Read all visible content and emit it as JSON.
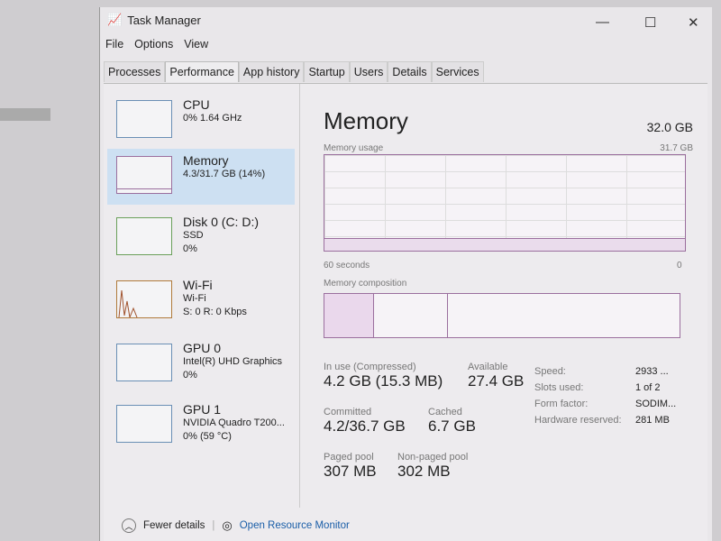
{
  "window": {
    "title": "Task Manager"
  },
  "menu": [
    "File",
    "Options",
    "View"
  ],
  "tabs": [
    "Processes",
    "Performance",
    "App history",
    "Startup",
    "Users",
    "Details",
    "Services"
  ],
  "active_tab": "Performance",
  "sidebar": [
    {
      "name": "CPU",
      "line1": "0% 1.64 GHz",
      "line2": ""
    },
    {
      "name": "Memory",
      "line1": "4.3/31.7 GB (14%)",
      "line2": ""
    },
    {
      "name": "Disk 0 (C: D:)",
      "line1": "SSD",
      "line2": "0%"
    },
    {
      "name": "Wi-Fi",
      "line1": "Wi-Fi",
      "line2": "S: 0 R: 0 Kbps"
    },
    {
      "name": "GPU 0",
      "line1": "Intel(R) UHD Graphics",
      "line2": "0%"
    },
    {
      "name": "GPU 1",
      "line1": "NVIDIA Quadro T200...",
      "line2": "0% (59 °C)"
    }
  ],
  "main": {
    "title": "Memory",
    "total": "32.0 GB",
    "usage_label": "Memory usage",
    "usage_max": "31.7 GB",
    "time_left": "60 seconds",
    "time_right": "0",
    "composition_label": "Memory composition",
    "stats": {
      "in_use_label": "In use (Compressed)",
      "in_use": "4.2 GB (15.3 MB)",
      "available_label": "Available",
      "available": "27.4 GB",
      "committed_label": "Committed",
      "committed": "4.2/36.7 GB",
      "cached_label": "Cached",
      "cached": "6.7 GB",
      "paged_label": "Paged pool",
      "paged": "307 MB",
      "nonpaged_label": "Non-paged pool",
      "nonpaged": "302 MB"
    },
    "details": [
      {
        "k": "Speed:",
        "v": "2933 ..."
      },
      {
        "k": "Slots used:",
        "v": "1 of 2"
      },
      {
        "k": "Form factor:",
        "v": "SODIM..."
      },
      {
        "k": "Hardware reserved:",
        "v": "281 MB"
      }
    ]
  },
  "footer": {
    "fewer": "Fewer details",
    "monitor": "Open Resource Monitor"
  }
}
